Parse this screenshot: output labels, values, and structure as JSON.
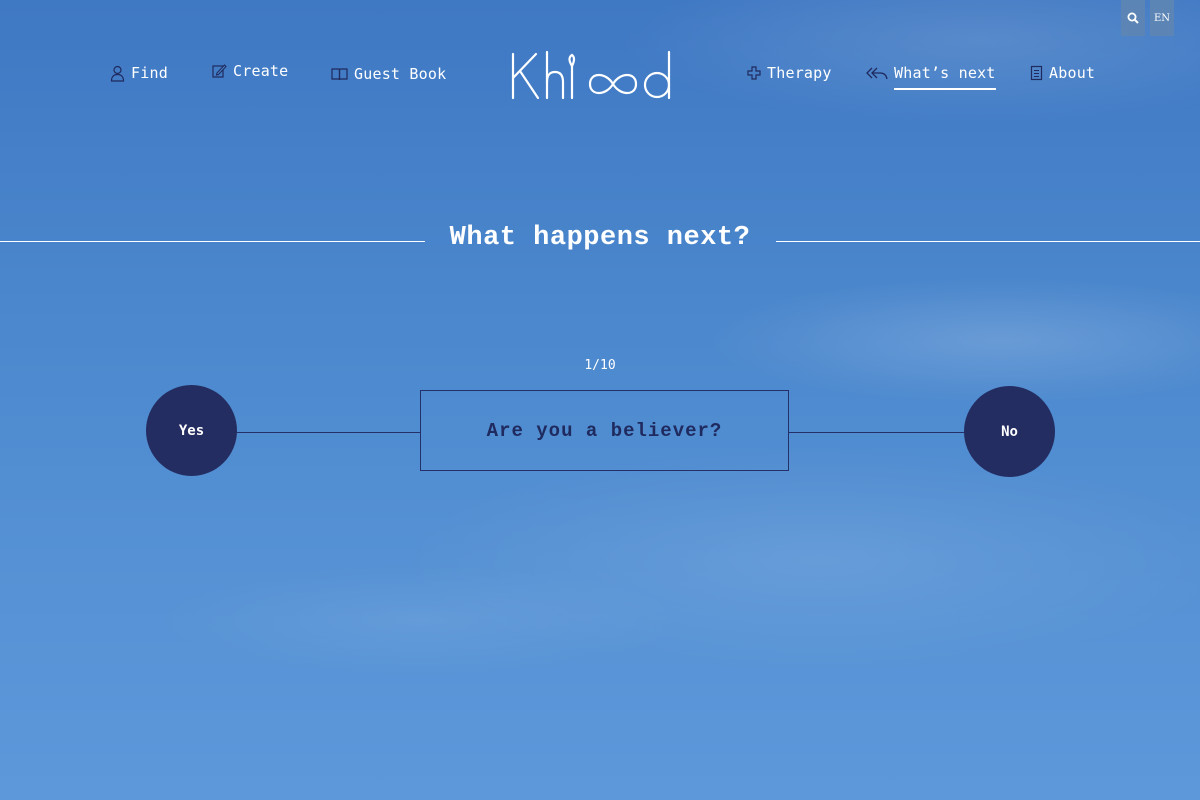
{
  "utils": {
    "search_icon": "search-icon",
    "language": "EN"
  },
  "nav": {
    "left": [
      {
        "label": "Find",
        "icon": "person-icon"
      },
      {
        "label": "Create",
        "icon": "edit-icon"
      },
      {
        "label": "Guest Book",
        "icon": "book-icon"
      }
    ],
    "logo_text": "Khlood",
    "right": [
      {
        "label": "Therapy",
        "icon": "plus-icon"
      },
      {
        "label": "What’s next",
        "icon": "reply-all-icon",
        "active": true
      },
      {
        "label": "About",
        "icon": "document-icon"
      }
    ]
  },
  "main": {
    "heading": "What happens next?",
    "counter": "1/10",
    "question": "Are you a believer?",
    "yes_label": "Yes",
    "no_label": "No"
  },
  "colors": {
    "sky_top": "#3f78c3",
    "sky_bottom": "#5c98da",
    "navy": "#242d61",
    "text": "#ffffff"
  }
}
